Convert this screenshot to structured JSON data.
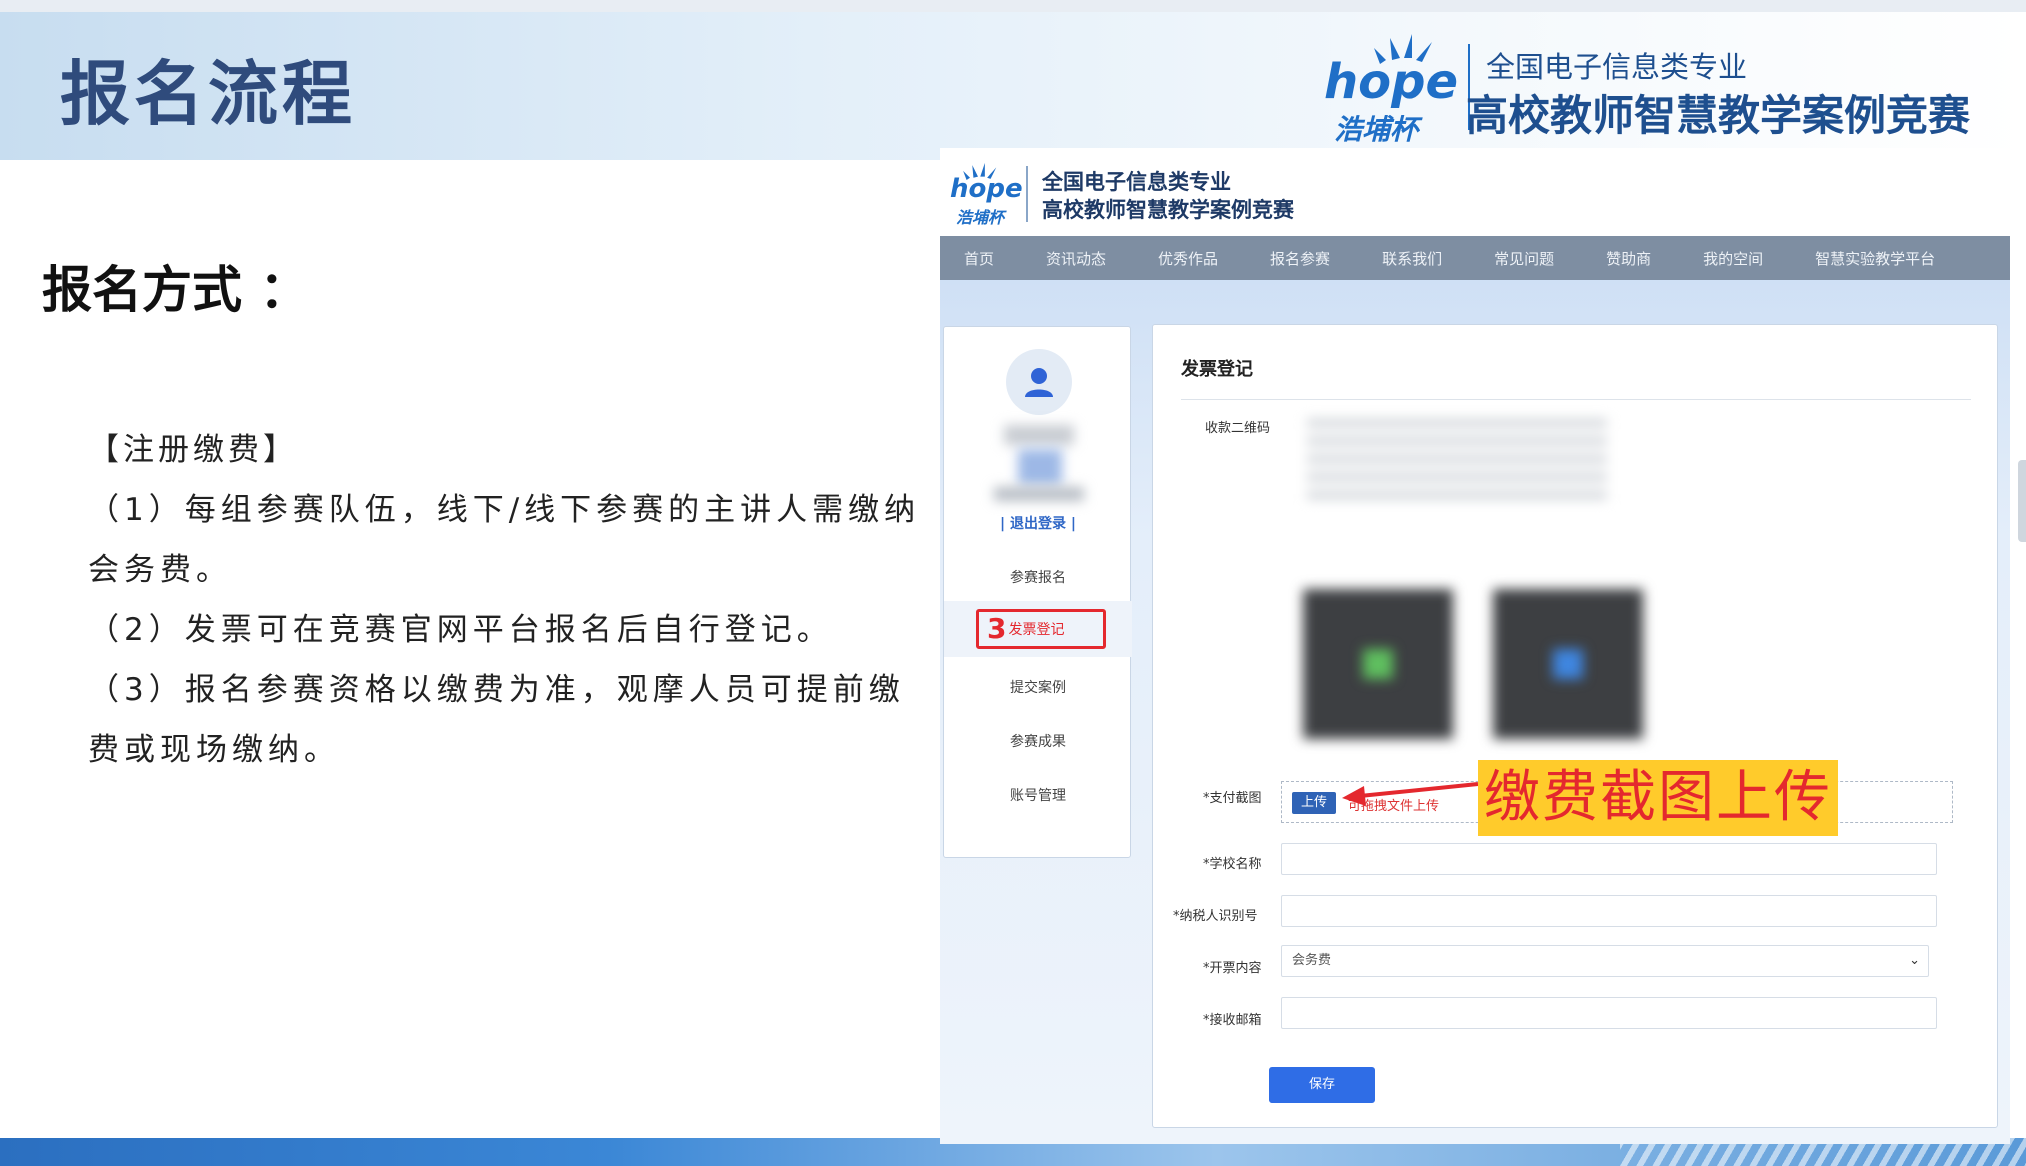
{
  "slide": {
    "title": "报名流程",
    "method_heading": "报名方式 ：",
    "section_title": "【注册缴费】",
    "items": [
      "（1）每组参赛队伍，线下/线下参赛的主讲人需缴纳会务费。",
      "（2）发票可在竞赛官网平台报名后自行登记。",
      "（3）报名参赛资格以缴费为准，观摩人员可提前缴费或现场缴纳。"
    ]
  },
  "logo": {
    "brand": "hope",
    "cup_name": "浩埔杯",
    "line1": "全国电子信息类专业",
    "line2": "高校教师智慧教学案例竞赛"
  },
  "site": {
    "nav": [
      "首页",
      "资讯动态",
      "优秀作品",
      "报名参赛",
      "联系我们",
      "常见问题",
      "赞助商",
      "我的空间",
      "智慧实验教学平台"
    ],
    "sidebar": {
      "logout": "| 退出登录 |",
      "items": [
        "参赛报名",
        "发票登记",
        "提交案例",
        "参赛成果",
        "账号管理"
      ],
      "step_number": "3"
    },
    "form": {
      "title": "发票登记",
      "qr_label": "收款二维码",
      "screenshot_label": "*支付截图",
      "upload_button": "上传",
      "upload_hint": "可拖拽文件上传",
      "school_label": "*学校名称",
      "taxid_label": "*纳税人识别号",
      "content_label": "*开票内容",
      "content_value": "会务费",
      "email_label": "*接收邮箱",
      "save_button": "保存"
    },
    "callout": "缴费截图上传"
  },
  "colors": {
    "title_blue": "#2f4b7c",
    "brand_blue": "#1f6fc7",
    "nav_gray": "#7e8ea2",
    "highlight_red": "#e4282e",
    "callout_yellow": "#ffcb2b",
    "save_blue": "#2f6de6"
  }
}
